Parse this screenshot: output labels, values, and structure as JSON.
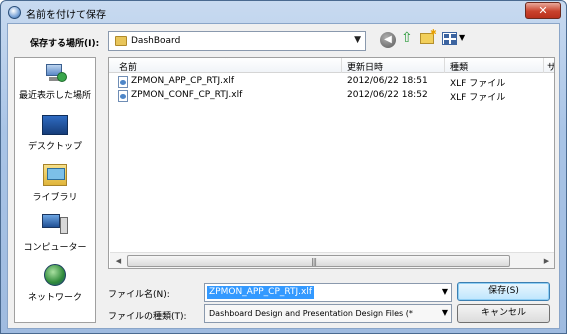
{
  "window": {
    "title": "名前を付けて保存",
    "close_glyph": "✕"
  },
  "location": {
    "label": "保存する場所(I):",
    "current": "DashBoard"
  },
  "places": [
    {
      "label": "最近表示した場所",
      "icon": "recent-places-icon"
    },
    {
      "label": "デスクトップ",
      "icon": "desktop-icon"
    },
    {
      "label": "ライブラリ",
      "icon": "libraries-icon"
    },
    {
      "label": "コンピューター",
      "icon": "computer-icon"
    },
    {
      "label": "ネットワーク",
      "icon": "network-icon"
    }
  ],
  "columns": [
    "名前",
    "更新日時",
    "種類",
    "サ"
  ],
  "files": [
    {
      "name": "ZPMON_APP_CP_RTJ.xlf",
      "modified": "2012/06/22 18:51",
      "type": "XLF ファイル"
    },
    {
      "name": "ZPMON_CONF_CP_RTJ.xlf",
      "modified": "2012/06/22 18:52",
      "type": "XLF ファイル"
    }
  ],
  "filename": {
    "label": "ファイル名(N):",
    "value": "ZPMON_APP_CP_RTJ.xlf"
  },
  "filetype": {
    "label": "ファイルの種類(T):",
    "value": "Dashboard Design and Presentation Design Files (*"
  },
  "buttons": {
    "save": "保存(S)",
    "cancel": "キャンセル"
  },
  "colors": {
    "selection": "#3399ff",
    "title_bar": "#a9c4e6",
    "close_button": "#c9422c"
  }
}
